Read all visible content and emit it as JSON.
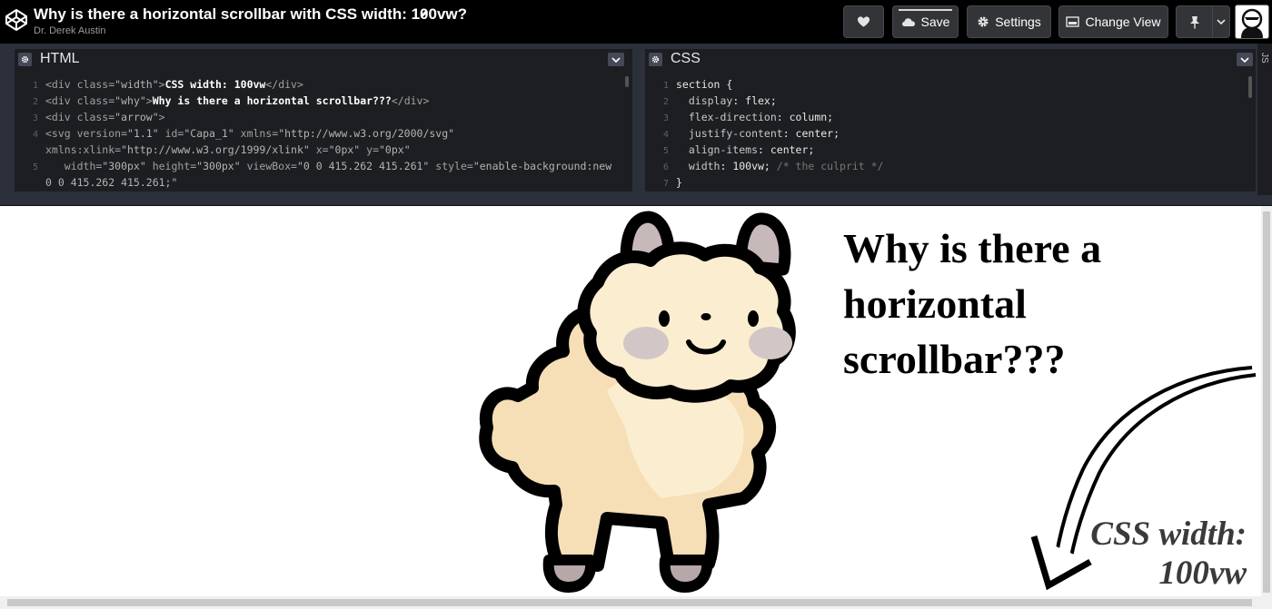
{
  "header": {
    "title": "Why is there a horizontal scrollbar with CSS width: 100vw?",
    "author": "Dr. Derek Austin",
    "buttons": {
      "save": "Save",
      "settings": "Settings",
      "change_view": "Change View"
    }
  },
  "editors": {
    "html": {
      "title": "HTML",
      "lines": [
        {
          "n": "1",
          "segments": [
            {
              "t": "<div class=",
              "c": "c-tag"
            },
            {
              "t": "\"width\"",
              "c": "c-str"
            },
            {
              "t": ">",
              "c": "c-tag"
            },
            {
              "t": "CSS width: 100vw",
              "c": "c-text"
            },
            {
              "t": "</div>",
              "c": "c-tag"
            }
          ]
        },
        {
          "n": "2",
          "segments": [
            {
              "t": "<div class=",
              "c": "c-tag"
            },
            {
              "t": "\"why\"",
              "c": "c-str"
            },
            {
              "t": ">",
              "c": "c-tag"
            },
            {
              "t": "Why is there a horizontal scrollbar???",
              "c": "c-text"
            },
            {
              "t": "</div>",
              "c": "c-tag"
            }
          ]
        },
        {
          "n": "3",
          "segments": [
            {
              "t": "<div class=",
              "c": "c-tag"
            },
            {
              "t": "\"arrow\"",
              "c": "c-str"
            },
            {
              "t": ">",
              "c": "c-tag"
            }
          ]
        },
        {
          "n": "4",
          "segments": [
            {
              "t": "<svg version=",
              "c": "c-tag"
            },
            {
              "t": "\"1.1\"",
              "c": "c-str"
            },
            {
              "t": " id=",
              "c": "c-tag"
            },
            {
              "t": "\"Capa_1\"",
              "c": "c-str"
            },
            {
              "t": " xmlns=",
              "c": "c-tag"
            },
            {
              "t": "\"http://www.w3.org/2000/svg\"",
              "c": "c-str"
            }
          ]
        },
        {
          "n": "",
          "segments": [
            {
              "t": "xmlns:xlink=",
              "c": "c-tag"
            },
            {
              "t": "\"http://www.w3.org/1999/xlink\"",
              "c": "c-str"
            },
            {
              "t": " x=",
              "c": "c-tag"
            },
            {
              "t": "\"0px\"",
              "c": "c-str"
            },
            {
              "t": " y=",
              "c": "c-tag"
            },
            {
              "t": "\"0px\"",
              "c": "c-str"
            }
          ]
        },
        {
          "n": "5",
          "segments": [
            {
              "t": "   width=",
              "c": "c-tag"
            },
            {
              "t": "\"300px\"",
              "c": "c-str"
            },
            {
              "t": " height=",
              "c": "c-tag"
            },
            {
              "t": "\"300px\"",
              "c": "c-str"
            },
            {
              "t": " viewBox=",
              "c": "c-tag"
            },
            {
              "t": "\"0 0 415.262 415.261\"",
              "c": "c-str"
            },
            {
              "t": " style=",
              "c": "c-tag"
            },
            {
              "t": "\"enable-background:new",
              "c": "c-str"
            }
          ]
        },
        {
          "n": "",
          "segments": [
            {
              "t": "0 0 415.262 415.261;\"",
              "c": "c-str"
            }
          ]
        }
      ]
    },
    "css": {
      "title": "CSS",
      "lines": [
        {
          "n": "1",
          "segments": [
            {
              "t": "section {",
              "c": "c-val"
            }
          ]
        },
        {
          "n": "2",
          "segments": [
            {
              "t": "  display",
              "c": "c-prop"
            },
            {
              "t": ": flex;",
              "c": "c-val"
            }
          ]
        },
        {
          "n": "3",
          "segments": [
            {
              "t": "  flex-direction",
              "c": "c-prop"
            },
            {
              "t": ": column;",
              "c": "c-val"
            }
          ]
        },
        {
          "n": "4",
          "segments": [
            {
              "t": "  justify-content",
              "c": "c-prop"
            },
            {
              "t": ": center;",
              "c": "c-val"
            }
          ]
        },
        {
          "n": "5",
          "segments": [
            {
              "t": "  align-items",
              "c": "c-prop"
            },
            {
              "t": ": center;",
              "c": "c-val"
            }
          ]
        },
        {
          "n": "6",
          "segments": [
            {
              "t": "  width",
              "c": "c-prop"
            },
            {
              "t": ": 100vw; ",
              "c": "c-val"
            },
            {
              "t": "/* the culprit */",
              "c": "c-cmt"
            }
          ]
        },
        {
          "n": "7",
          "segments": [
            {
              "t": "}",
              "c": "c-val"
            }
          ]
        }
      ]
    },
    "js": {
      "title": "JS"
    }
  },
  "preview": {
    "heading": "Why is there a horizontal scrollbar???",
    "width_text": "CSS width: 100vw"
  },
  "icons": {
    "logo": "codepen-logo-icon",
    "edit": "pencil-icon",
    "like": "heart-icon",
    "save": "cloud-icon",
    "settings": "gear-icon",
    "change_view": "layout-icon",
    "pin": "pin-icon",
    "more": "chevron-down-icon"
  },
  "colors": {
    "header_bg": "#000000",
    "button_bg": "#333438",
    "editor_bg": "#1d1e22",
    "editor_chrome": "#2c303a",
    "llama_body": "#fbeed0",
    "llama_outline": "#000000"
  }
}
